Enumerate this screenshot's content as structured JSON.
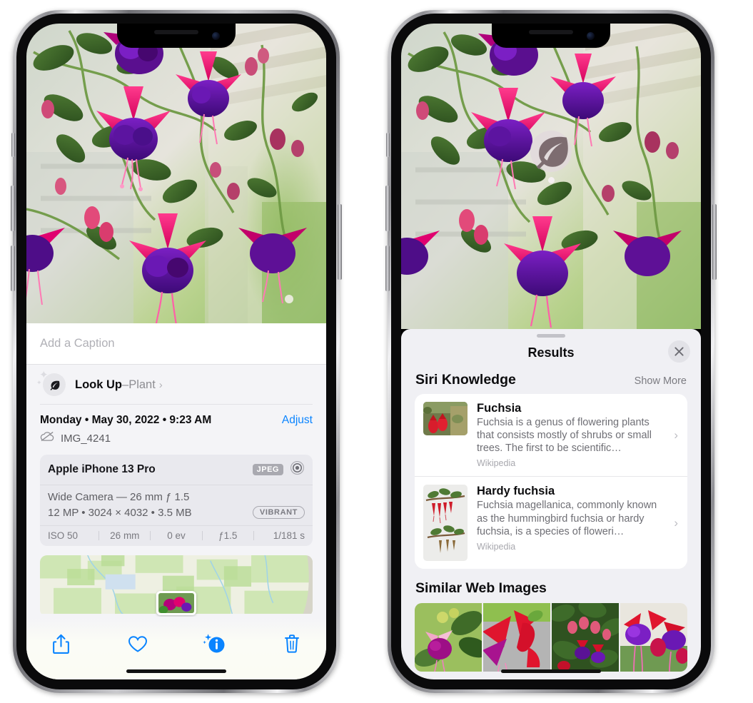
{
  "left_phone": {
    "name": "photos-detail-view",
    "caption": {
      "placeholder": "Add a Caption",
      "value": ""
    },
    "lookup": {
      "icon": "leaf-icon",
      "label": "Look Up",
      "dash": " – ",
      "subject": "Plant",
      "chevron": "›"
    },
    "meta": {
      "date": "Monday • May 30, 2022 • 9:23 AM",
      "adjust_label": "Adjust",
      "cloud_icon": "icloud-slash-icon",
      "file_name": "IMG_4241"
    },
    "camera_card": {
      "model": "Apple iPhone 13 Pro",
      "format_badge": "JPEG",
      "lens_icon": "aperture-icon",
      "lens_line": "Wide Camera — 26 mm ƒ 1.5",
      "stats_line": "12 MP • 3024 × 4032 • 3.5 MB",
      "style_badge": "VIBRANT",
      "exif": [
        "ISO 50",
        "26 mm",
        "0 ev",
        "ƒ1.5",
        "1/181 s"
      ]
    },
    "map": {
      "name": "location-map-preview",
      "pin": "photo-pin-thumbnail"
    },
    "toolbar": [
      {
        "name": "share-button",
        "icon": "share-icon"
      },
      {
        "name": "favorite-button",
        "icon": "heart-icon"
      },
      {
        "name": "info-button",
        "icon": "info-sparkle-icon"
      },
      {
        "name": "delete-button",
        "icon": "trash-icon"
      }
    ],
    "accent": "#0a84ff"
  },
  "right_phone": {
    "name": "visual-lookup-results-view",
    "photo_badge": {
      "name": "leaf-lookup-badge",
      "icon": "leaf-icon"
    },
    "sheet": {
      "title": "Results",
      "close_icon": "close-icon",
      "siri_knowledge": {
        "heading": "Siri Knowledge",
        "show_more": "Show More",
        "results": [
          {
            "title": "Fuchsia",
            "description": "Fuchsia is a genus of flowering plants that consists mostly of shrubs or small trees. The first to be scientific…",
            "source": "Wikipedia",
            "thumb": "fuchsia-red-flowers-thumbnail",
            "chevron": "›"
          },
          {
            "title": "Hardy fuchsia",
            "description": "Fuchsia magellanica, commonly known as the hummingbird fuchsia or hardy fuchsia, is a species of floweri…",
            "source": "Wikipedia",
            "thumb": "hardy-fuchsia-branch-thumbnail",
            "chevron": "›"
          }
        ]
      },
      "similar_web_images": {
        "heading": "Similar Web Images",
        "thumbnails": [
          "fuchsia-pink-white-bloom",
          "fuchsia-red-closeup",
          "fuchsia-shrub-buds",
          "fuchsia-purple-red-cluster"
        ]
      }
    }
  }
}
